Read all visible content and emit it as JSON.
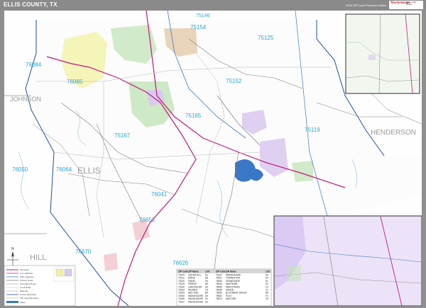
{
  "header": {
    "title": "ELLIS COUNTY, TX",
    "edition": "2023 ZIP Code Premium Edition",
    "logo_text": "Marketmaps",
    "logo_sub": "Map of Zip Codes"
  },
  "map": {
    "county_name": "ELLIS",
    "neighbor_counties": [
      "JOHNSON",
      "HENDERSON",
      "HILL"
    ],
    "zip_labels": [
      "75154",
      "75146",
      "75125",
      "76084",
      "76065",
      "75152",
      "75165",
      "75167",
      "75119",
      "76064",
      "76050",
      "76041",
      "76651",
      "76670",
      "76626"
    ],
    "colors": {
      "water": "#3a78c7",
      "highway": "#c2187f",
      "road": "#7a7a7a",
      "county_boundary": "#1d4fa0",
      "zip_label": "#2aa5d8",
      "county_label": "#9a9a9a",
      "city_purple": "#c8b7e3",
      "city_yellow": "#f3f1a8",
      "city_green": "#bfe3b3",
      "city_pink": "#f0c4cc",
      "city_tan": "#e3c9a8"
    },
    "compass_letter": "N"
  },
  "legend": {
    "items": [
      "Interstate",
      "U.S. Highway",
      "State Highway",
      "Primary Road",
      "Secondary Road",
      "Local Road",
      "Railroad",
      "County Boundary",
      "ZIP Code Boundary",
      "Water"
    ]
  },
  "zip_table": {
    "headers": [
      "ZIP Code",
      "ZIP Name",
      "LOC",
      "ZIP Code",
      "ZIP Name",
      "LOC"
    ],
    "rows": [
      [
        "75104",
        "CEDAR HILL",
        "D1",
        "75167",
        "WAXAHACHIE",
        "D4"
      ],
      [
        "75119",
        "ENNIS",
        "D6",
        "76041",
        "FORRESTON",
        "E4"
      ],
      [
        "75119",
        "ENNIS",
        "H4",
        "76050",
        "GRANDVIEW",
        "E1"
      ],
      [
        "75125",
        "FERRIS",
        "B5",
        "76064",
        "MAYPEARL",
        "E2"
      ],
      [
        "75146",
        "LANCASTER",
        "A4",
        "76065",
        "MIDLOTHIAN",
        "C2"
      ],
      [
        "75152",
        "PALMER",
        "C5",
        "76084",
        "VENUS",
        "C1"
      ],
      [
        "75154",
        "RED OAK",
        "B4",
        "76626",
        "BLOOMING GROVE",
        "H5"
      ],
      [
        "75165",
        "WAXAHACHIE",
        "D4",
        "76651",
        "ITALY",
        "F4"
      ],
      [
        "75165",
        "WAXAHACHIE",
        "E4",
        "76670",
        "MILFORD",
        "G3"
      ],
      [
        "75167",
        "WAXAHACHIE",
        "E3",
        "",
        "",
        ""
      ]
    ]
  }
}
